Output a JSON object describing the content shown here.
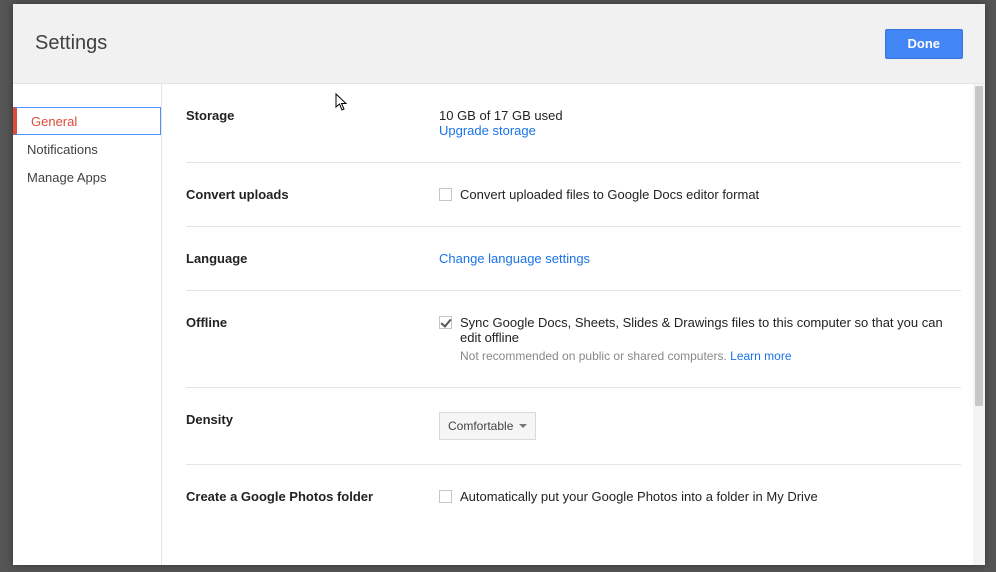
{
  "header": {
    "title": "Settings",
    "done": "Done"
  },
  "sidebar": {
    "items": [
      {
        "label": "General",
        "active": true
      },
      {
        "label": "Notifications",
        "active": false
      },
      {
        "label": "Manage Apps",
        "active": false
      }
    ]
  },
  "sections": {
    "storage": {
      "label": "Storage",
      "usage": "10 GB of 17 GB used",
      "upgrade": "Upgrade storage"
    },
    "convert": {
      "label": "Convert uploads",
      "checkbox_label": "Convert uploaded files to Google Docs editor format",
      "checked": false
    },
    "language": {
      "label": "Language",
      "link": "Change language settings"
    },
    "offline": {
      "label": "Offline",
      "checkbox_label": "Sync Google Docs, Sheets, Slides & Drawings files to this computer so that you can edit offline",
      "checked": true,
      "note": "Not recommended on public or shared computers.",
      "learn_more": "Learn more"
    },
    "density": {
      "label": "Density",
      "value": "Comfortable"
    },
    "photos": {
      "label": "Create a Google Photos folder",
      "checkbox_label": "Automatically put your Google Photos into a folder in My Drive",
      "checked": false
    }
  }
}
